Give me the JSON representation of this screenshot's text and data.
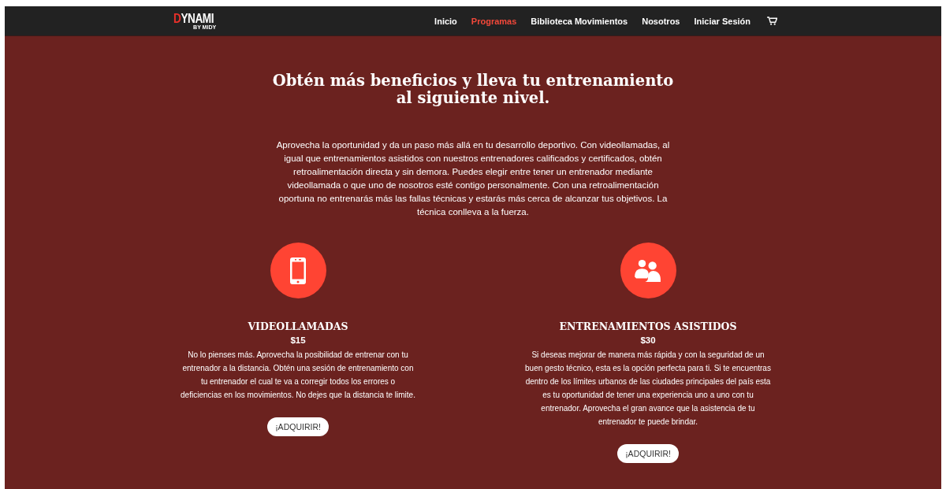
{
  "header": {
    "logo": "DYNAMI",
    "logo_sub": "BY MIDY",
    "nav": [
      {
        "label": "Inicio",
        "selected": false
      },
      {
        "label": "Programas",
        "selected": true
      },
      {
        "label": "Biblioteca Movimientos",
        "selected": false
      },
      {
        "label": "Nosotros",
        "selected": false
      },
      {
        "label": "Iniciar Sesión",
        "selected": false
      }
    ]
  },
  "intro": {
    "title": "Obtén más beneficios y lleva tu entrenamiento al siguiente nivel.",
    "text": "Aprovecha la oportunidad y da un paso más allá en tu desarrollo deportivo. Con videollamadas, al igual que entrenamientos asistidos con nuestros entrenadores calificados y certificados, obtén retroalimentación directa y sin demora. Puedes elegir entre tener un entrenador mediante videollamada o que uno de nosotros esté contigo personalmente. Con una retroalimentación oportuna no entrenarás más las fallas técnicas y estarás más cerca de alcanzar tus objetivos. La técnica conlleva a la fuerza."
  },
  "plans": [
    {
      "kind": "phone",
      "title": "VIDEOLLAMADAS",
      "price": "$15",
      "text": "No lo pienses más. Aprovecha la posibilidad de entrenar con tu entrenador a la distancia. Obtén una sesión de entrenamiento con tu entrenador el cual te va a corregir todos los errores o deficiencias en los movimientos. No dejes que la distancia te limite.",
      "button": "¡ADQUIRIR!"
    },
    {
      "kind": "people",
      "title": "ENTRENAMIENTOS ASISTIDOS",
      "price": "$30",
      "text": "Si deseas mejorar de manera más rápida y con la seguridad de un buen gesto técnico, esta es la opción perfecta para ti. Si te encuentras dentro de los límites urbanos de las ciudades principales del país esta es tu oportunidad de tener una experiencia uno a uno con tu entrenador. Aprovecha el gran avance que  la asistencia de tu entrenador te puede brindar.",
      "button": "¡ADQUIRIR!"
    }
  ]
}
